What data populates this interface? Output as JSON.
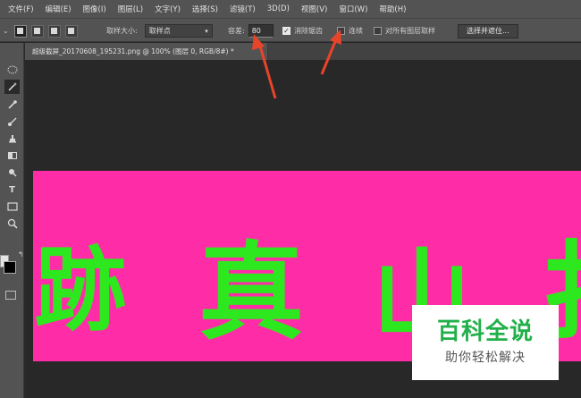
{
  "menu": [
    "文件(F)",
    "编辑(E)",
    "图像(I)",
    "图层(L)",
    "文字(Y)",
    "选择(S)",
    "滤镜(T)",
    "3D(D)",
    "视图(V)",
    "窗口(W)",
    "帮助(H)"
  ],
  "options": {
    "sample_size_label": "取样大小:",
    "sample_size_value": "取样点",
    "tolerance_label": "容差:",
    "tolerance_value": "80",
    "antialias_label": "消除锯齿",
    "contiguous_label": "连续",
    "all_layers_label": "对所有图层取样",
    "select_mask_button": "选择并遮住..."
  },
  "document": {
    "tab_title": "超级截屏_20170608_195231.png @ 100% (图层 0, RGB/8#) *"
  },
  "canvas": {
    "glyphs": [
      "跡",
      "真",
      "山",
      "扌"
    ]
  },
  "watermark": {
    "title": "百科全说",
    "subtitle": "助你轻松解决"
  },
  "colors": {
    "ui_dark": "#535353",
    "canvas_bg": "#282828",
    "image_bg": "#ff2ca8",
    "glyph": "#2ee81f",
    "arrow": "#e8442a",
    "watermark_green": "#22b04a"
  }
}
